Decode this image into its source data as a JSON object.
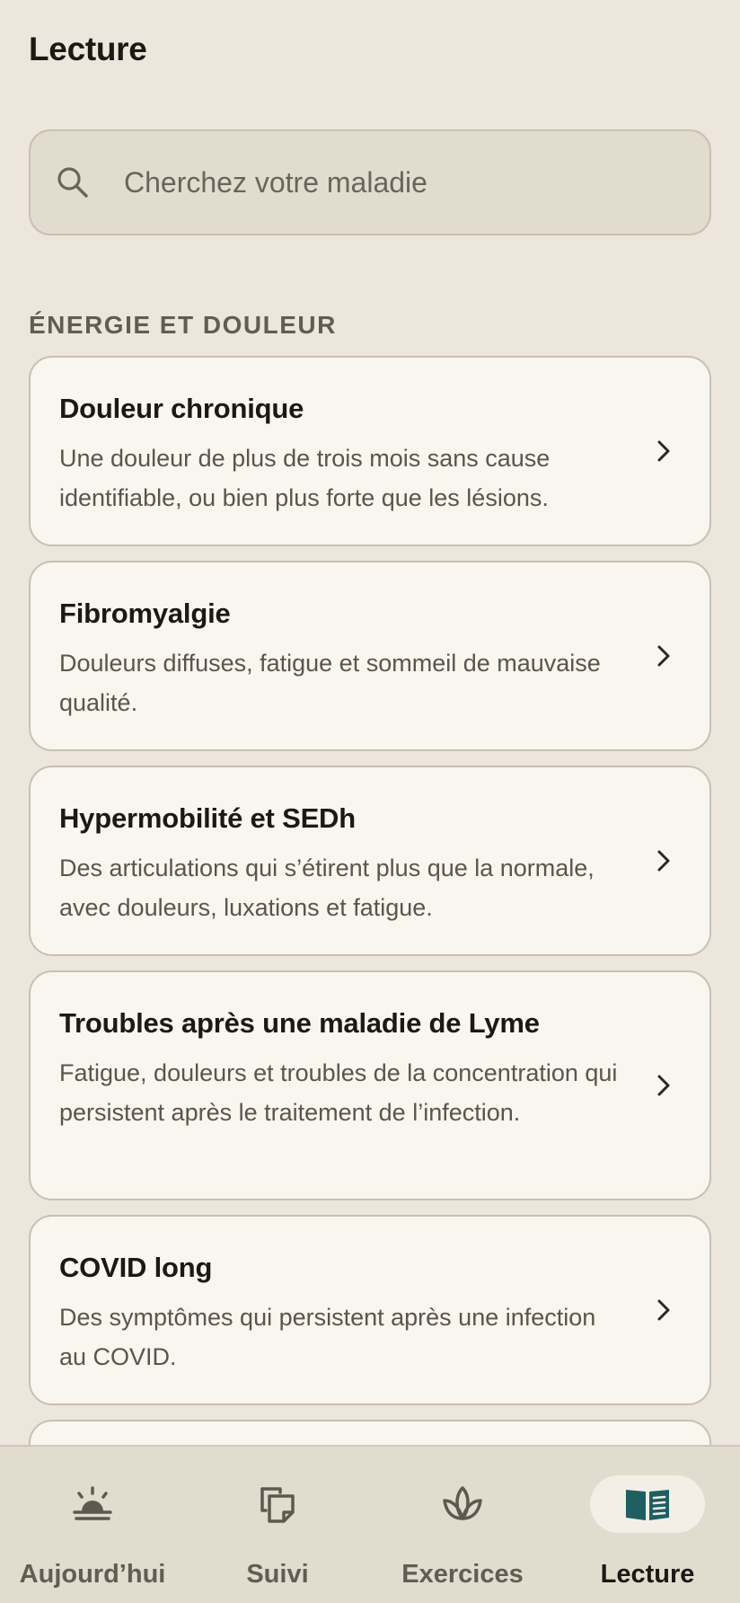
{
  "header": {
    "title": "Lecture"
  },
  "search": {
    "placeholder": "Cherchez votre maladie",
    "icon": "search-icon"
  },
  "section": {
    "title": "ÉNERGIE ET DOULEUR"
  },
  "cards": [
    {
      "title": "Douleur chronique",
      "description": "Une douleur de plus de trois mois sans cause identifiable, ou bien plus forte que les lésions."
    },
    {
      "title": "Fibromyalgie",
      "description": "Douleurs diffuses, fatigue et sommeil de mauvaise qualité."
    },
    {
      "title": "Hypermobilité et SEDh",
      "description": "Des articulations qui s’étirent plus que la normale, avec douleurs, luxations et fatigue."
    },
    {
      "title": "Troubles après une maladie de Lyme",
      "description": "Fatigue, douleurs et troubles de la concentration qui persistent après le traitement de l’infection."
    },
    {
      "title": "COVID long",
      "description": "Des symptômes qui persistent après une infection au COVID."
    }
  ],
  "nav": {
    "items": [
      {
        "label": "Aujourd’hui",
        "icon": "sunrise-icon",
        "active": false
      },
      {
        "label": "Suivi",
        "icon": "pages-icon",
        "active": false
      },
      {
        "label": "Exercices",
        "icon": "lotus-icon",
        "active": false
      },
      {
        "label": "Lecture",
        "icon": "open-book-icon",
        "active": true
      }
    ]
  },
  "colors": {
    "background": "#ece6dc",
    "card": "#f9f5ef",
    "border": "#c8c0b2",
    "nav_background": "#e2dccf",
    "active_icon": "#1f5f62",
    "muted_text": "#625c52"
  }
}
